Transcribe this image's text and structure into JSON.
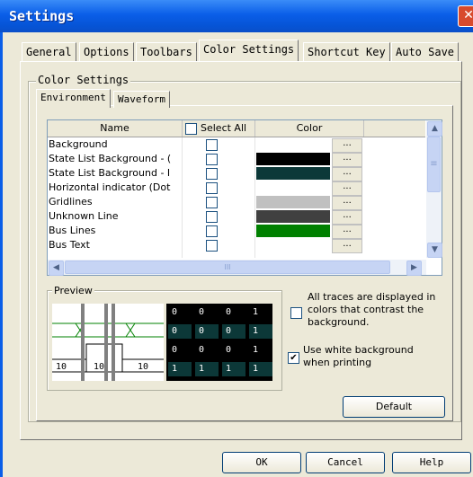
{
  "window": {
    "title": "Settings",
    "close_glyph": "✕"
  },
  "tabs": [
    "General",
    "Options",
    "Toolbars",
    "Color Settings",
    "Shortcut Key",
    "Auto Save"
  ],
  "active_tab": 3,
  "group": {
    "label": "Color Settings"
  },
  "subtabs": [
    "Environment",
    "Waveform"
  ],
  "grid": {
    "headers": {
      "name": "Name",
      "select_all": "Select All",
      "color": "Color"
    },
    "dots_label": "...",
    "rows": [
      {
        "name": "Background",
        "color": "#ffffff"
      },
      {
        "name": "State List Background - (",
        "color": "#000000"
      },
      {
        "name": "State List Background - I",
        "color": "#0c3838"
      },
      {
        "name": "Horizontal indicator (Dot",
        "color": "#ffffff"
      },
      {
        "name": "Gridlines",
        "color": "#c0c0c0"
      },
      {
        "name": "Unknown Line",
        "color": "#404040"
      },
      {
        "name": "Bus Lines",
        "color": "#008000"
      },
      {
        "name": "Bus Text",
        "color": "#ffffff"
      }
    ],
    "scroll_up": "▲",
    "scroll_down": "▼",
    "scroll_left": "◀",
    "scroll_right": "▶",
    "grip": "≡",
    "hgrip": "III"
  },
  "preview": {
    "label": "Preview",
    "labels": [
      "10",
      "10",
      "10"
    ],
    "binary": [
      [
        "0",
        "0",
        "0",
        "1"
      ],
      [
        "0",
        "0",
        "0",
        "1"
      ],
      [
        "0",
        "0",
        "0",
        "1"
      ],
      [
        "1",
        "1",
        "1",
        "1"
      ]
    ],
    "binary_colors": [
      "#000000",
      "#0c3838",
      "#000000",
      "#0c3838"
    ]
  },
  "options": {
    "contrast_label": "All traces are displayed in colors that contrast the background.",
    "contrast_checked": false,
    "white_bg_label": "Use white background when printing",
    "white_bg_checked": true,
    "check_glyph": "✔"
  },
  "buttons": {
    "default": "Default",
    "ok": "OK",
    "cancel": "Cancel",
    "help": "Help"
  }
}
